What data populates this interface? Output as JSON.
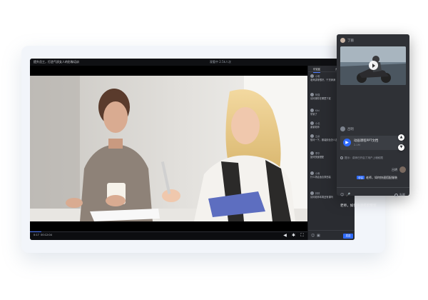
{
  "titlebar": {
    "course_title": "提升员工，打造气质女人的形象培训",
    "meta": "观看中 2.5k人次",
    "right": "•••"
  },
  "video": {
    "time_current": "0:17",
    "time_total": "00:12:04",
    "progress": 0.04
  },
  "chat": {
    "tabs": [
      "讨论区",
      "资料区"
    ],
    "messages": [
      {
        "name": "小明",
        "text": "老师讲得很好，干货满满"
      },
      {
        "name": "阿强",
        "text": "请问课件在哪里下载"
      },
      {
        "name": "Kiki",
        "text": "学到了"
      },
      {
        "name": "小北",
        "text": "谢谢老师"
      },
      {
        "name": "云朵",
        "text": "想问一下，服装颜色怎么选"
      },
      {
        "name": "李华",
        "text": "如何快速搭配"
      },
      {
        "name": "小雨",
        "text": "什么场合适合穿西装"
      },
      {
        "name": "林林",
        "text": "请问老师本周还有课吗"
      }
    ],
    "send_label": "发送"
  },
  "popup": {
    "user_name": "丁丽",
    "sender_name": "吕明",
    "doc_title": "动画课程PPT文档",
    "doc_size": "2.1M",
    "notice": "提示：讲师已开启了用户上墙权限",
    "self_name": "吕明",
    "self_tag": "@吕",
    "self_text": "老师，如何快速搭配服装",
    "private_label": "私聊",
    "typed_text": "老师，如何快速搭配服装",
    "emoji_icon": "☺",
    "mic_icon": "🎤"
  },
  "colors": {
    "accent": "#2f6bff",
    "panel": "#2f3136",
    "player": "#1a1b1f"
  }
}
